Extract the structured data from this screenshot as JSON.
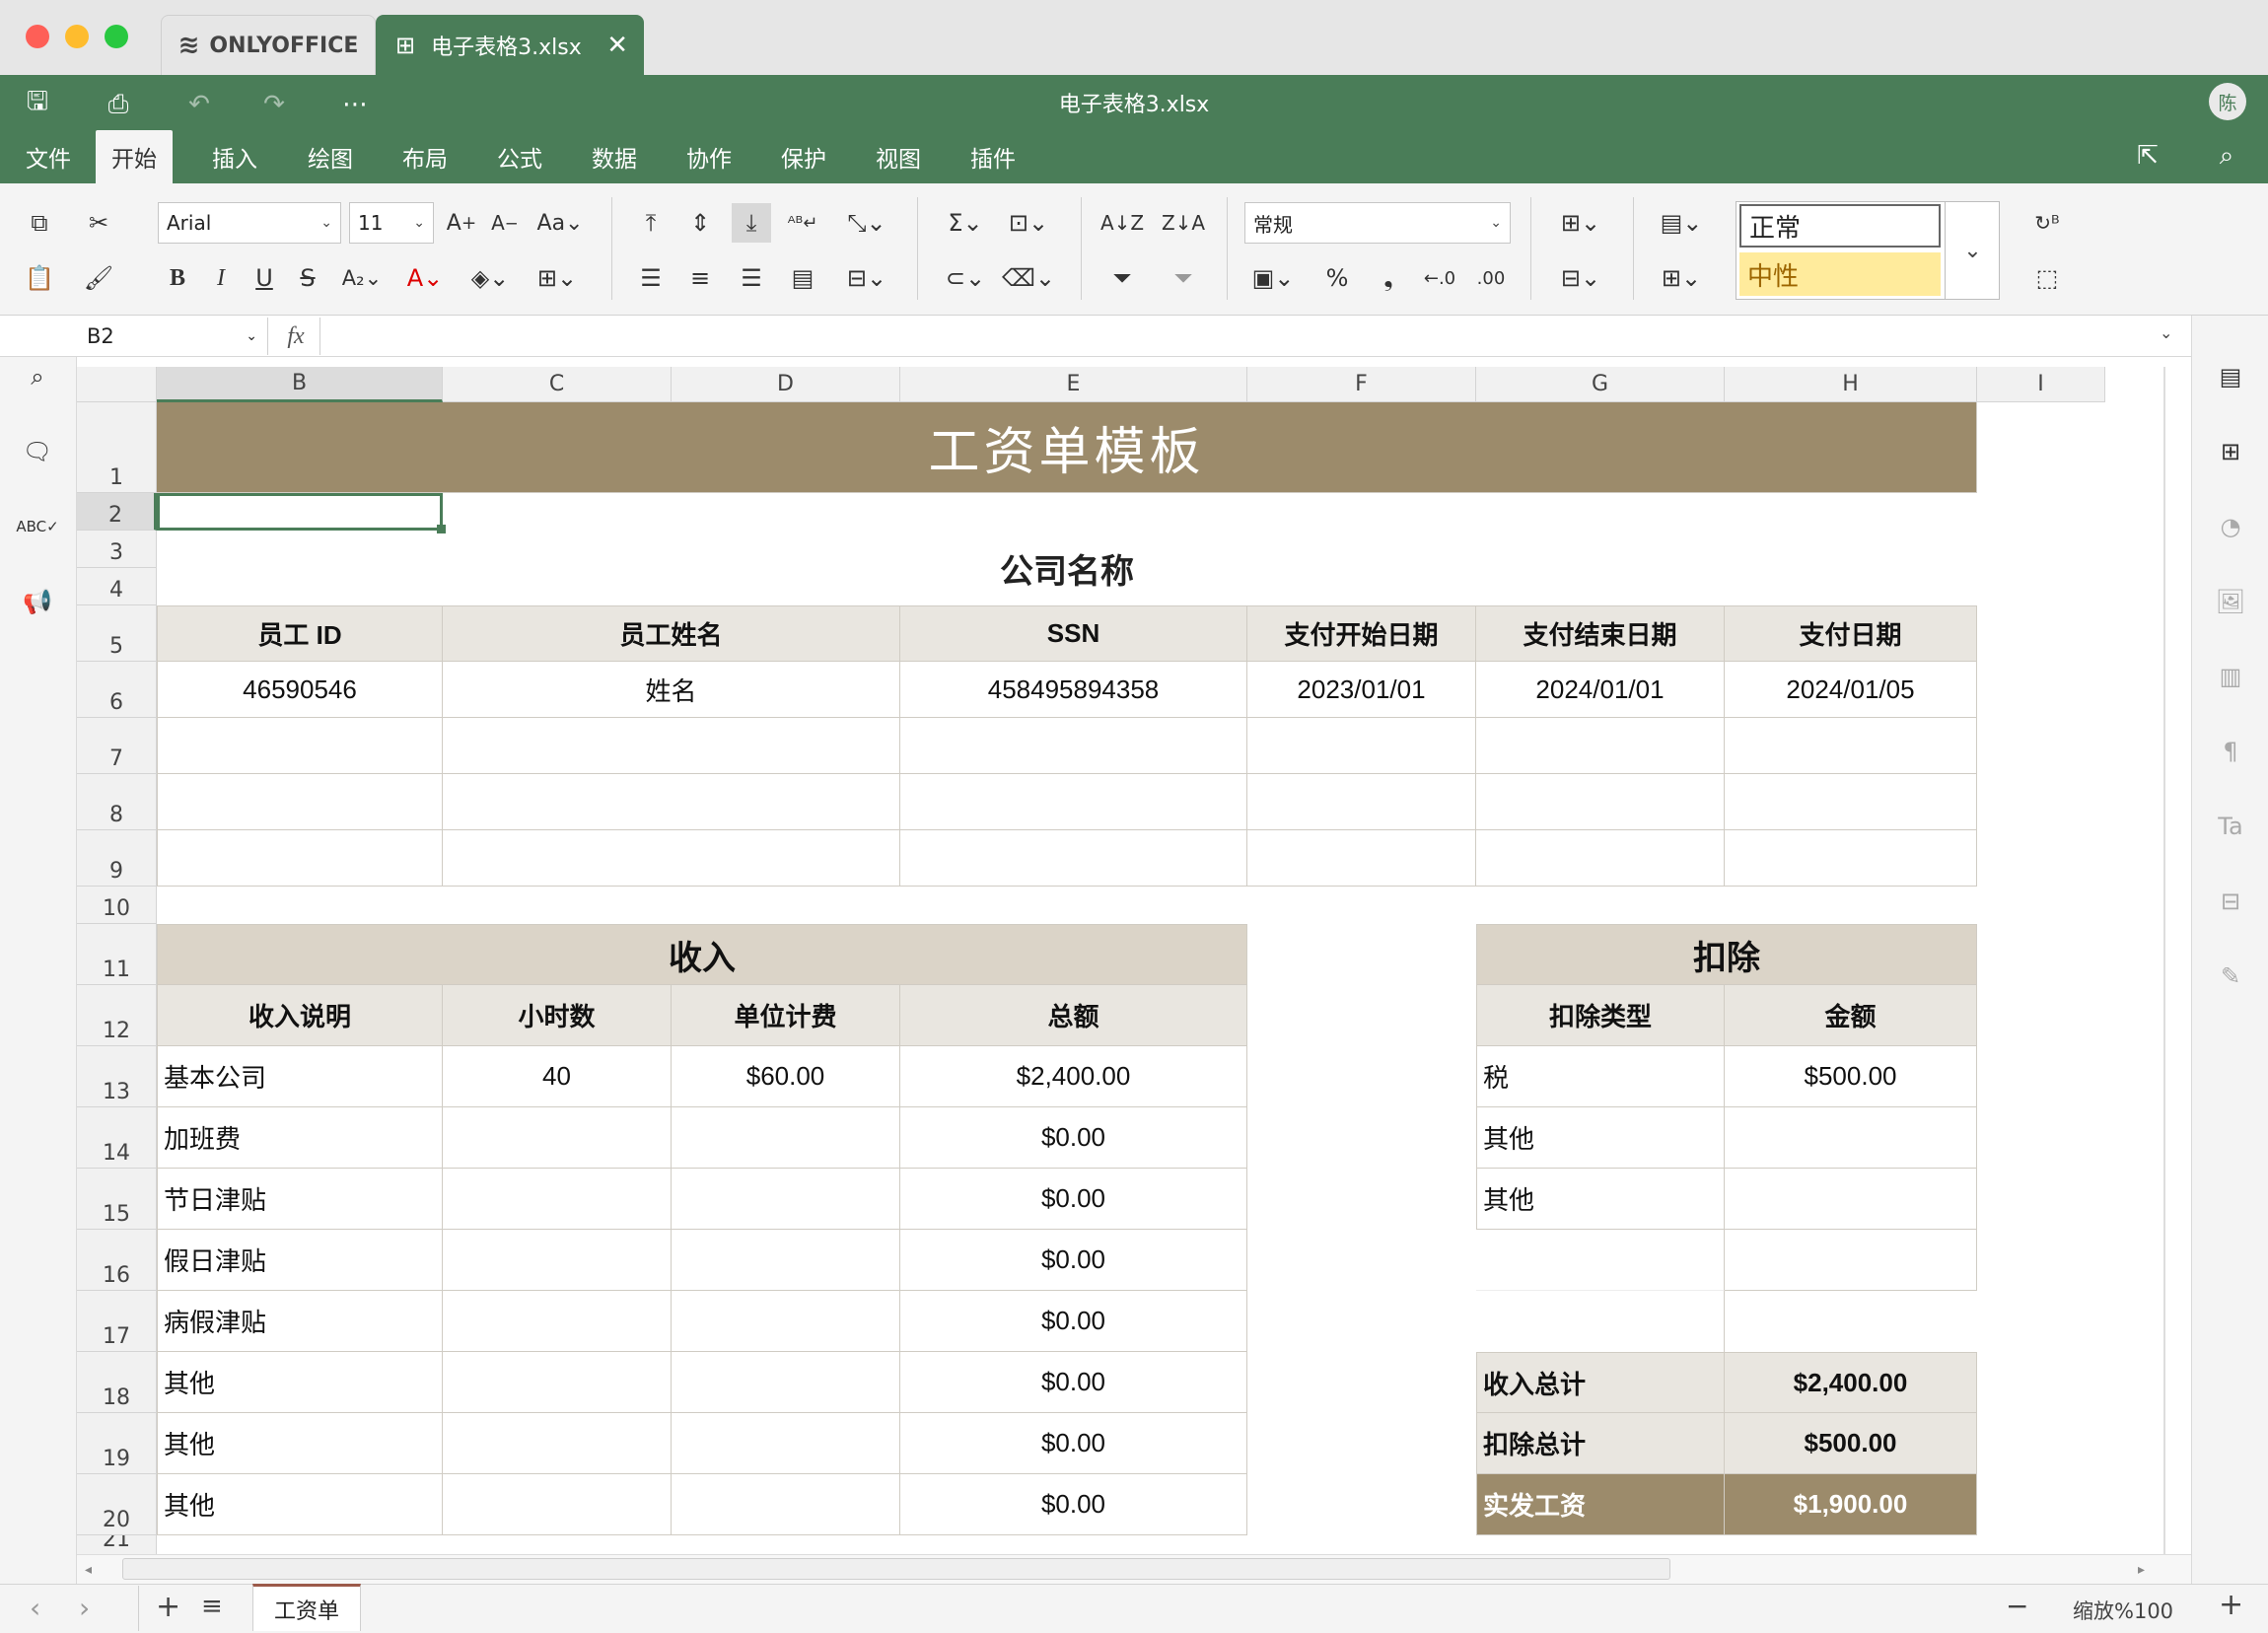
{
  "window": {
    "title": "电子表格3.xlsx"
  },
  "tabs": {
    "home": "ONLYOFFICE",
    "doc": "电子表格3.xlsx"
  },
  "user": {
    "avatar": "陈"
  },
  "menu": [
    "文件",
    "开始",
    "插入",
    "绘图",
    "布局",
    "公式",
    "数据",
    "协作",
    "保护",
    "视图",
    "插件"
  ],
  "ribbon": {
    "font_name": "Arial",
    "font_size": "11",
    "number_format": "常规",
    "style_normal": "正常",
    "style_neutral": "中性"
  },
  "formula": {
    "cell_ref": "B2",
    "fx": "fx",
    "value": ""
  },
  "columns": [
    "B",
    "C",
    "D",
    "E",
    "F",
    "G",
    "H",
    "I"
  ],
  "rows": [
    "1",
    "2",
    "3",
    "4",
    "5",
    "6",
    "7",
    "8",
    "9",
    "10",
    "11",
    "12",
    "13",
    "14",
    "15",
    "16",
    "17",
    "18",
    "19",
    "20",
    "21"
  ],
  "sheet": {
    "title": "工资单模板",
    "company": "公司名称",
    "info_headers": [
      "员工 ID",
      "员工姓名",
      "SSN",
      "支付开始日期",
      "支付结束日期",
      "支付日期"
    ],
    "info_values": [
      "46590546",
      "姓名",
      "458495894358",
      "2023/01/01",
      "2024/01/01",
      "2024/01/05"
    ],
    "income": {
      "title": "收入",
      "headers": [
        "收入说明",
        "小时数",
        "单位计费",
        "总额"
      ],
      "rows": [
        [
          "基本公司",
          "40",
          "$60.00",
          "$2,400.00"
        ],
        [
          "加班费",
          "",
          "",
          "$0.00"
        ],
        [
          "节日津贴",
          "",
          "",
          "$0.00"
        ],
        [
          "假日津贴",
          "",
          "",
          "$0.00"
        ],
        [
          "病假津贴",
          "",
          "",
          "$0.00"
        ],
        [
          "其他",
          "",
          "",
          "$0.00"
        ],
        [
          "其他",
          "",
          "",
          "$0.00"
        ],
        [
          "其他",
          "",
          "",
          "$0.00"
        ]
      ]
    },
    "deduction": {
      "title": "扣除",
      "headers": [
        "扣除类型",
        "金额"
      ],
      "rows": [
        [
          "税",
          "$500.00"
        ],
        [
          "其他",
          ""
        ],
        [
          "其他",
          ""
        ]
      ]
    },
    "totals": [
      [
        "收入总计",
        "$2,400.00"
      ],
      [
        "扣除总计",
        "$500.00"
      ],
      [
        "实发工资",
        "$1,900.00"
      ]
    ]
  },
  "status": {
    "sheet_tab": "工资单",
    "zoom": "缩放%100"
  },
  "colors": {
    "brand": "#4a7d58",
    "title_band": "#9c8b6b",
    "header_fill": "#e9e6e0",
    "group_fill": "#dbd4c8"
  }
}
